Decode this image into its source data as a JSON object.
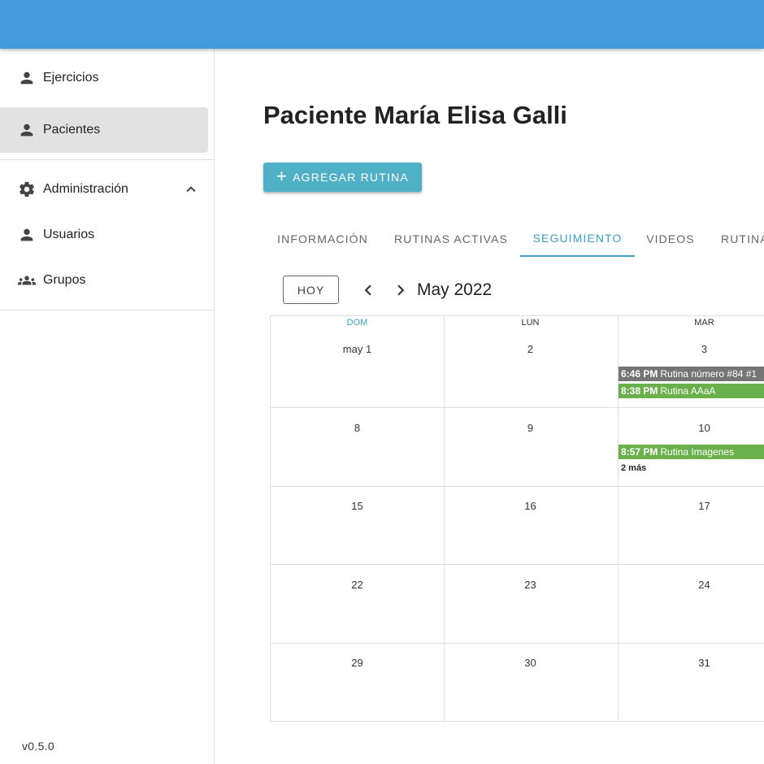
{
  "sidebar": {
    "items": [
      {
        "label": "Ejercicios",
        "icon": "person-icon"
      },
      {
        "label": "Pacientes",
        "icon": "person-icon"
      },
      {
        "label": "Administración",
        "icon": "gear-icon"
      },
      {
        "label": "Usuarios",
        "icon": "person-icon"
      },
      {
        "label": "Grupos",
        "icon": "group-icon"
      }
    ],
    "version": "v0.5.0"
  },
  "main": {
    "title": "Paciente María Elisa Galli",
    "add_button": "AGREGAR RUTINA",
    "tabs": [
      {
        "label": "INFORMACIÓN"
      },
      {
        "label": "RUTINAS ACTIVAS"
      },
      {
        "label": "SEGUIMIENTO"
      },
      {
        "label": "VIDEOS"
      },
      {
        "label": "RUTINAS"
      }
    ]
  },
  "calendar": {
    "today_button": "HOY",
    "month_label": "May 2022",
    "weekdays": [
      "DOM",
      "LUN",
      "MAR"
    ],
    "weeks": [
      [
        "may 1",
        "2",
        "3"
      ],
      [
        "8",
        "9",
        "10"
      ],
      [
        "15",
        "16",
        "17"
      ],
      [
        "22",
        "23",
        "24"
      ],
      [
        "29",
        "30",
        "31"
      ]
    ],
    "events": [
      {
        "time": "6:46 PM",
        "title": "Rutina número #84 #1",
        "color": "#757575"
      },
      {
        "time": "8:38 PM",
        "title": "Rutina AAaA",
        "color": "#6ab04c"
      },
      {
        "time": "8:57 PM",
        "title": "Rutina Imagenes",
        "color": "#6ab04c"
      }
    ],
    "more_label": "2 más"
  },
  "colors": {
    "appbar": "#459bdb",
    "accent": "#3aa0c2",
    "button": "#4fb0c6"
  }
}
